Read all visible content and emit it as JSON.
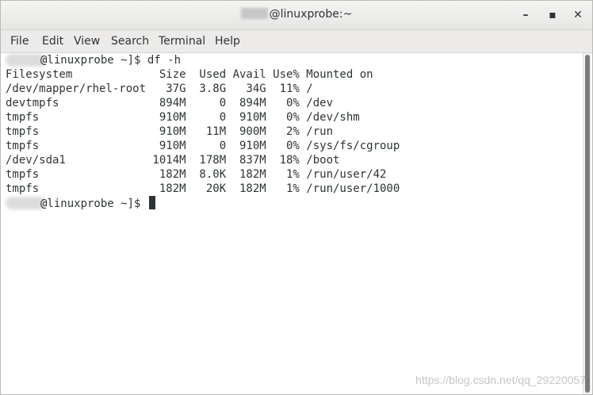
{
  "window": {
    "title_suffix": "@linuxprobe:~",
    "buttons": {
      "minimize": "–",
      "maximize": "▪",
      "close": "✕"
    }
  },
  "menu": [
    "File",
    "Edit",
    "View",
    "Search",
    "Terminal",
    "Help"
  ],
  "terminal": {
    "prompt_suffix": "@linuxprobe ~]$ ",
    "command": "df -h",
    "lines": [
      "Filesystem             Size  Used Avail Use% Mounted on",
      "/dev/mapper/rhel-root   37G  3.8G   34G  11% /",
      "devtmpfs               894M     0  894M   0% /dev",
      "tmpfs                  910M     0  910M   0% /dev/shm",
      "tmpfs                  910M   11M  900M   2% /run",
      "tmpfs                  910M     0  910M   0% /sys/fs/cgroup",
      "/dev/sda1             1014M  178M  837M  18% /boot",
      "tmpfs                  182M  8.0K  182M   1% /run/user/42",
      "tmpfs                  182M   20K  182M   1% /run/user/1000"
    ]
  },
  "watermark": "https://blog.csdn.net/qq_29220057"
}
